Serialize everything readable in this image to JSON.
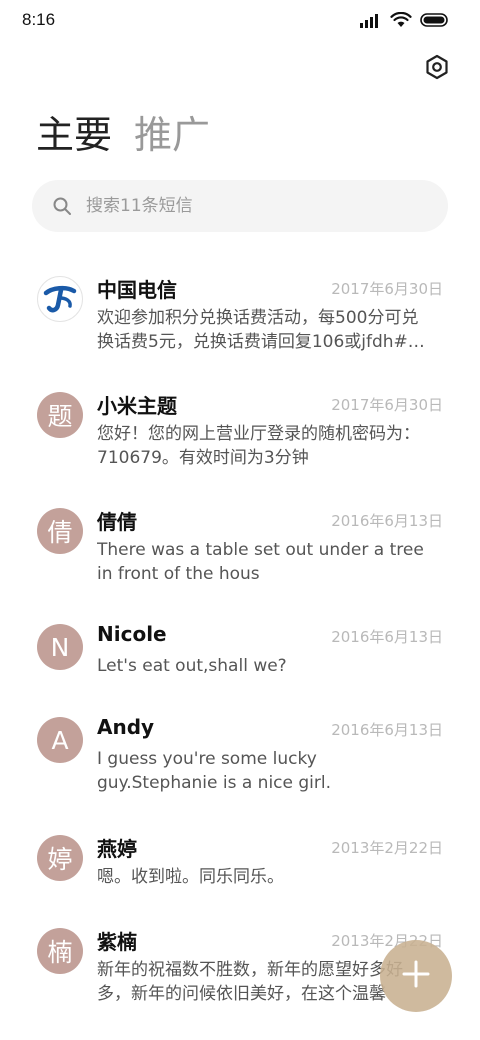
{
  "status_bar": {
    "time": "8:16"
  },
  "header": {
    "settings_icon": "gear-hexagon-icon"
  },
  "tabs": [
    {
      "label": "主要",
      "active": true
    },
    {
      "label": "推广",
      "active": false
    }
  ],
  "search": {
    "placeholder": "搜索11条短信",
    "value": ""
  },
  "conversations": [
    {
      "name": "中国电信",
      "date": "2017年6月30日",
      "preview": "欢迎参加积分兑换话费活动，每500分可兑换话费5元，兑换话费请回复106或jfdh#…",
      "avatar_char": "",
      "avatar_icon": "china-telecom-logo"
    },
    {
      "name": "小米主题",
      "date": "2017年6月30日",
      "preview": "您好！您的网上营业厅登录的随机密码为：710679。有效时间为3分钟",
      "avatar_char": "题"
    },
    {
      "name": "倩倩",
      "date": "2016年6月13日",
      "preview": "There was a table set out under a tree in front of the hous",
      "avatar_char": "倩"
    },
    {
      "name": "Nicole",
      "date": "2016年6月13日",
      "preview": "Let's eat out,shall we?",
      "avatar_char": "N"
    },
    {
      "name": "Andy",
      "date": "2016年6月13日",
      "preview": "I guess you're some lucky guy.Stephanie is a nice girl.",
      "avatar_char": "A"
    },
    {
      "name": "燕婷",
      "date": "2013年2月22日",
      "preview": "嗯。收到啦。同乐同乐。",
      "avatar_char": "婷"
    },
    {
      "name": "紫楠",
      "date": "2013年2月22日",
      "preview": "新年的祝福数不胜数，新年的愿望好多好多，新年的问候依旧美好，在这个温馨",
      "avatar_char": "楠"
    }
  ],
  "fab": {
    "icon": "plus-icon"
  },
  "colors": {
    "avatar_bg": "#c3a19a",
    "fab_bg": "#c8b091",
    "date_text": "#b9b9b9",
    "search_bg": "#f4f4f4"
  }
}
